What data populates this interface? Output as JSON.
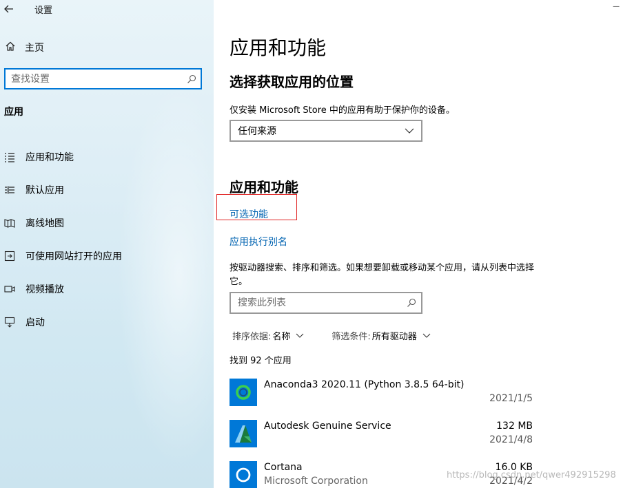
{
  "window": {
    "title": "设置"
  },
  "sidebar": {
    "home_label": "主页",
    "search_placeholder": "查找设置",
    "section_heading": "应用",
    "items": [
      {
        "label": "应用和功能"
      },
      {
        "label": "默认应用"
      },
      {
        "label": "离线地图"
      },
      {
        "label": "可使用网站打开的应用"
      },
      {
        "label": "视频播放"
      },
      {
        "label": "启动"
      }
    ]
  },
  "main": {
    "title": "应用和功能",
    "source_heading": "选择获取应用的位置",
    "source_desc": "仅安装 Microsoft Store 中的应用有助于保护你的设备。",
    "source_value": "任何来源",
    "apps_heading": "应用和功能",
    "optional_features_link": "可选功能",
    "app_alias_link": "应用执行别名",
    "list_desc": "按驱动器搜索、排序和筛选。如果想要卸载或移动某个应用，请从列表中选择它。",
    "list_search_placeholder": "搜索此列表",
    "sort_label": "排序依据:",
    "sort_value": "名称",
    "filter_label": "筛选条件:",
    "filter_value": "所有驱动器",
    "found_text": "找到 92 个应用",
    "apps": [
      {
        "name": "Anaconda3 2020.11 (Python 3.8.5 64-bit)",
        "sub": "",
        "size": "",
        "date": "2021/1/5"
      },
      {
        "name": "Autodesk Genuine Service",
        "sub": "",
        "size": "132 MB",
        "date": "2021/4/8"
      },
      {
        "name": "Cortana",
        "sub": "Microsoft Corporation",
        "size": "16.0 KB",
        "date": "2021/4/2"
      }
    ]
  },
  "watermark": "https://blog.csdn.net/qwer492915298",
  "colors": {
    "accent": "#0078d7",
    "link": "#0063b1",
    "highlight": "#e02020"
  }
}
